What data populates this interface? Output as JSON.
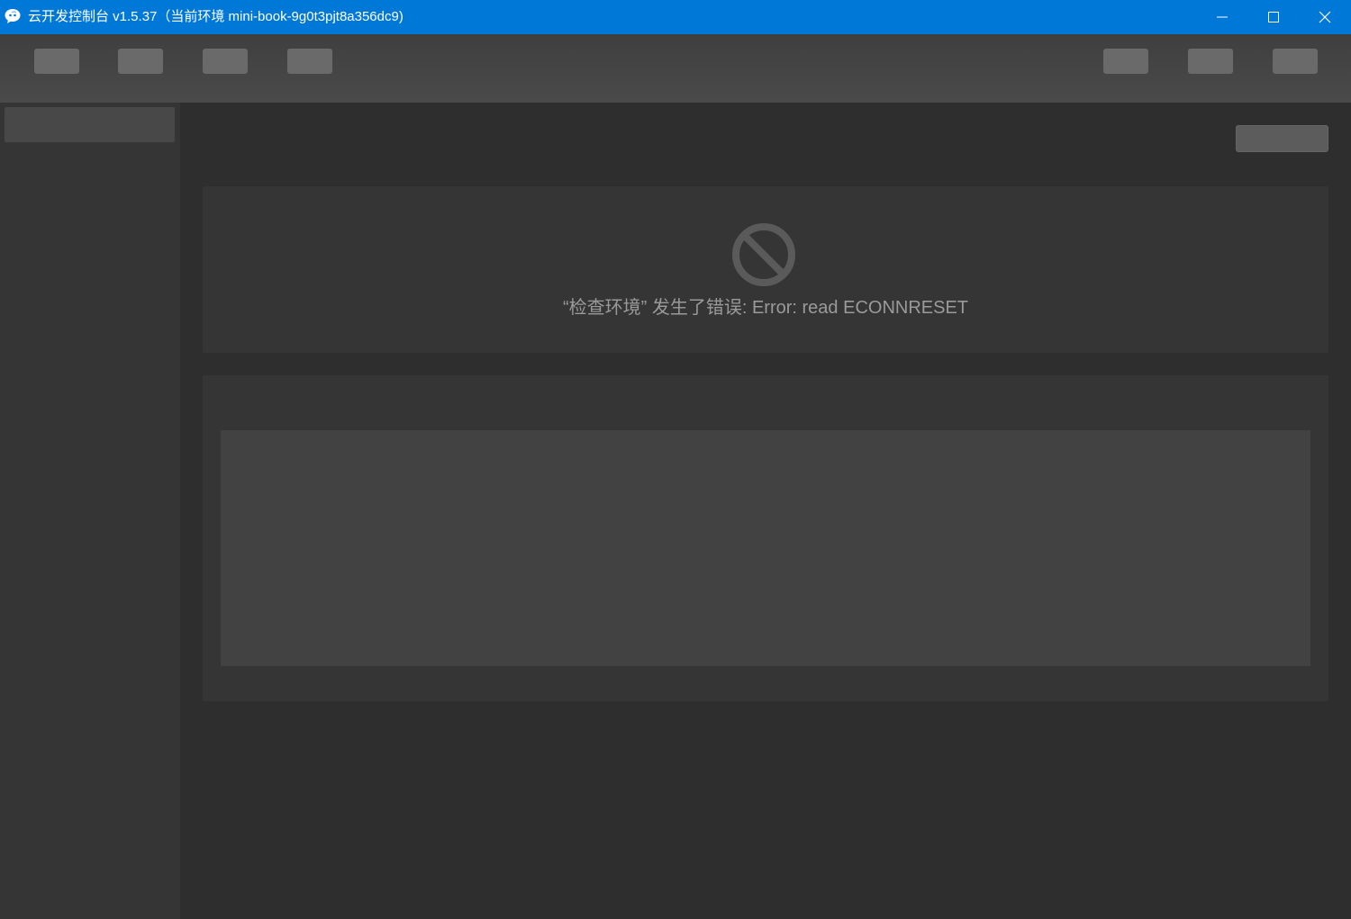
{
  "window": {
    "title": "云开发控制台 v1.5.37（当前环境 mini-book-9g0t3pjt8a356dc9)",
    "accent_color": "#0078d7",
    "controls": [
      "minimize-icon",
      "maximize-icon",
      "close-icon"
    ]
  },
  "toolbar": {
    "left_buttons": 4,
    "right_buttons": 3
  },
  "main": {
    "error": {
      "icon": "prohibited-icon",
      "message": "“检查环境” 发生了错误: Error: read ECONNRESET"
    }
  }
}
